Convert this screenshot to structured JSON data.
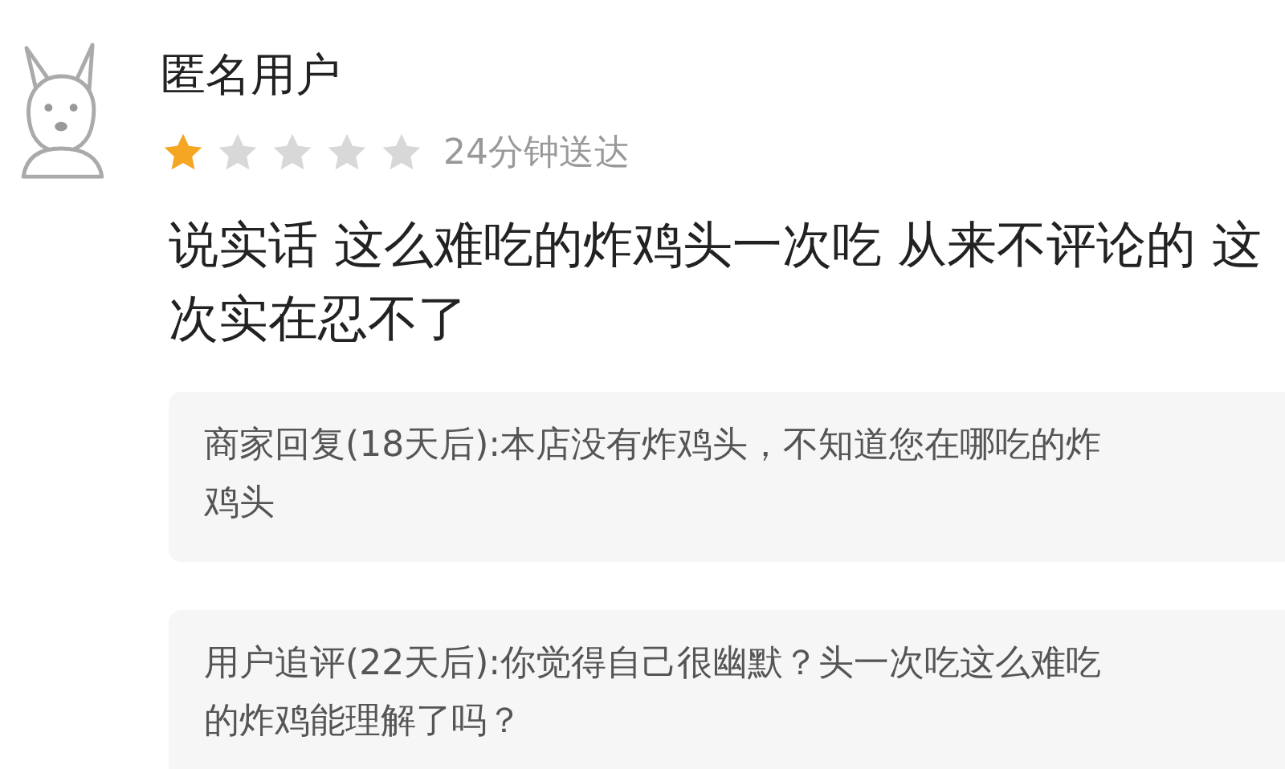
{
  "review": {
    "user_name": "匿名用户",
    "stars": 1,
    "delivery_time": "24分钟送达",
    "text": "说实话 这么难吃的炸鸡头一次吃 从来不评论的 这次实在忍不了"
  },
  "replies": [
    {
      "text": "商家回复(18天后):本店没有炸鸡头，不知道您在哪吃的炸鸡头"
    },
    {
      "text": "用户追评(22天后):你觉得自己很幽默？头一次吃这么难吃的炸鸡能理解了吗？"
    }
  ]
}
